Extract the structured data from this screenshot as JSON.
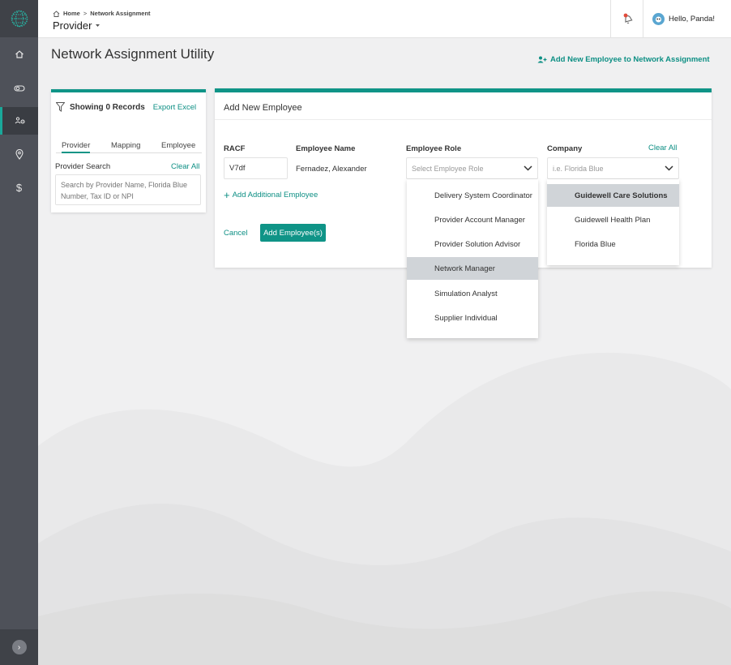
{
  "header": {
    "breadcrumb": {
      "home": "Home",
      "separator": ">",
      "current": "Network Assignment"
    },
    "app_switcher": "Provider",
    "greeting": "Hello, Panda!"
  },
  "page": {
    "title": "Network Assignment Utility",
    "add_new_link": "Add New Employee to Network Assignment"
  },
  "left_panel": {
    "records": "Showing 0 Records",
    "export": "Export Excel",
    "tabs": [
      "Provider",
      "Mapping",
      "Employee"
    ],
    "search_label": "Provider Search",
    "clear_all": "Clear All",
    "search_placeholder": "Search by Provider Name, Florida Blue Number, Tax ID or NPI"
  },
  "card": {
    "title": "Add New Employee",
    "columns": {
      "racf": "RACF",
      "name": "Employee Name",
      "role": "Employee Role",
      "company": "Company"
    },
    "clear_all": "Clear All",
    "racf_value": "V7df",
    "employee_name": "Fernadez, Alexander",
    "role_placeholder": "Select Employee Role",
    "company_placeholder": "i.e. Florida Blue",
    "add_additional": "Add Additional Employee",
    "cancel": "Cancel",
    "submit": "Add Employee(s)"
  },
  "role_options": [
    "Delivery System Coordinator",
    "Provider Account Manager",
    "Provider Solution Advisor",
    "Network Manager",
    "Simulation Analyst",
    "Supplier Individual"
  ],
  "company_options": [
    "Guidewell Care Solutions",
    "Guidewell Health Plan",
    "Florida Blue"
  ],
  "colors": {
    "accent": "#0f9487",
    "link": "#0d8f84",
    "sidebar": "#4e5159"
  }
}
